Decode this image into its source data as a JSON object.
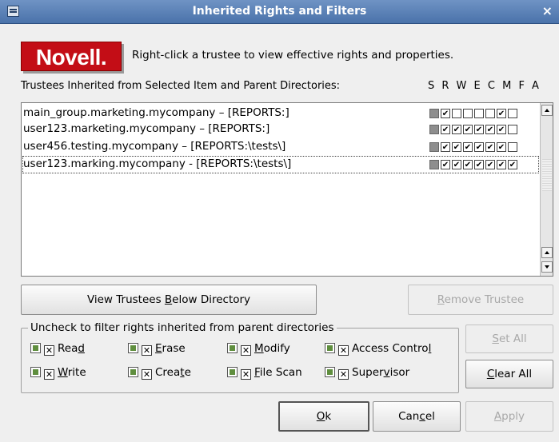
{
  "window": {
    "title": "Inherited Rights and Filters",
    "close_glyph": "×",
    "menu_icon": "window-menu-icon"
  },
  "logo": {
    "text": "Novell",
    "mark": "."
  },
  "hint": "Right-click a trustee to view effective rights and properties.",
  "trustees": {
    "label": "Trustees Inherited from Selected Item and Parent Directories:",
    "rights_header": "S R W E C M F A",
    "rows": [
      {
        "name": "main_group.marketing.mycompany – [REPORTS:]",
        "rights": [
          false,
          true,
          false,
          false,
          false,
          false,
          true,
          false
        ],
        "selected": false
      },
      {
        "name": "user123.marketing.mycompany – [REPORTS:]",
        "rights": [
          false,
          true,
          true,
          true,
          true,
          true,
          true,
          false
        ],
        "selected": false
      },
      {
        "name": "user456.testing.mycompany – [REPORTS:\\tests\\]",
        "rights": [
          false,
          true,
          true,
          true,
          true,
          true,
          true,
          false
        ],
        "selected": false
      },
      {
        "name": "user123.marking.mycompany - [REPORTS:\\tests\\]",
        "rights": [
          false,
          true,
          true,
          true,
          true,
          true,
          true,
          true
        ],
        "selected": true
      }
    ]
  },
  "buttons": {
    "view_below_prefix": "View Trustees ",
    "view_below_mnemonic": "B",
    "view_below_suffix": "elow Directory",
    "remove_mnemonic": "R",
    "remove_rest": "emove Trustee",
    "set_all_mnemonic": "S",
    "set_all_rest": "et All",
    "clear_all_mnemonic": "C",
    "clear_all_rest": "lear All",
    "ok_mnemonic": "O",
    "ok_rest": "k",
    "cancel_pre": "Can",
    "cancel_mnemonic": "c",
    "cancel_post": "el",
    "apply_pre": "",
    "apply_mnemonic": "A",
    "apply_post": "pply"
  },
  "filters": {
    "legend": "Uncheck to filter rights inherited from parent directories",
    "items": [
      {
        "pre": "Rea",
        "mn": "d",
        "post": "",
        "checked": true
      },
      {
        "pre": "",
        "mn": "E",
        "post": "rase",
        "checked": true
      },
      {
        "pre": "",
        "mn": "M",
        "post": "odify",
        "checked": true
      },
      {
        "pre": "Access Contro",
        "mn": "l",
        "post": "",
        "checked": true
      },
      {
        "pre": "",
        "mn": "W",
        "post": "rite",
        "checked": true
      },
      {
        "pre": "Crea",
        "mn": "t",
        "post": "e",
        "checked": true
      },
      {
        "pre": "",
        "mn": "F",
        "post": "ile Scan",
        "checked": true
      },
      {
        "pre": "Super",
        "mn": "v",
        "post": "isor",
        "checked": true
      }
    ],
    "check_glyph": "✕"
  },
  "colors": {
    "titlebar": "#5a80b8",
    "logo_red": "#c30d16",
    "background": "#efefef"
  }
}
